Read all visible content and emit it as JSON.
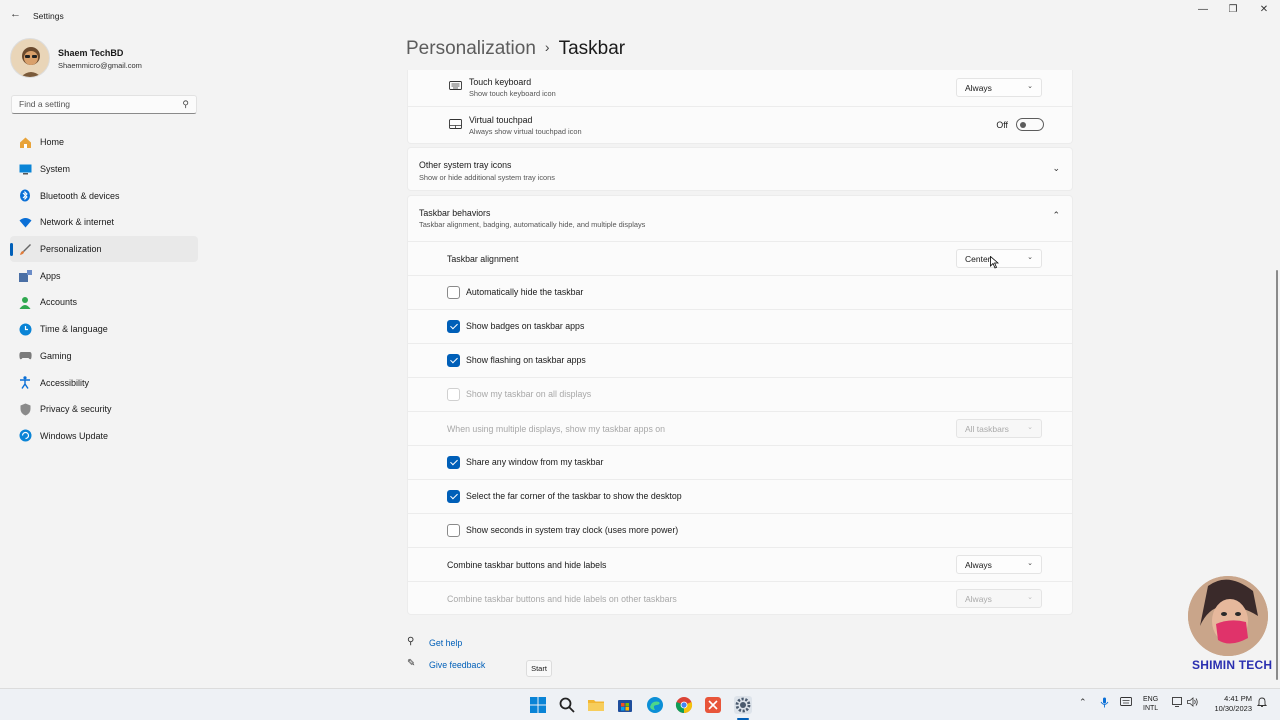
{
  "window": {
    "title": "Settings",
    "controls": [
      "—",
      "❐",
      "✕"
    ]
  },
  "profile": {
    "name": "Shaem TechBD",
    "email": "Shaemmicro@gmail.com"
  },
  "search": {
    "placeholder": "Find a setting"
  },
  "sidebar": {
    "items": [
      {
        "label": "Home",
        "icon": "home-icon",
        "color": "#d97706"
      },
      {
        "label": "System",
        "icon": "monitor-icon",
        "color": "#0078d4"
      },
      {
        "label": "Bluetooth & devices",
        "icon": "bluetooth-icon",
        "color": "#0078d4"
      },
      {
        "label": "Network & internet",
        "icon": "wifi-icon",
        "color": "#0078d4"
      },
      {
        "label": "Personalization",
        "icon": "brush-icon",
        "color": "#e07b39"
      },
      {
        "label": "Apps",
        "icon": "apps-icon",
        "color": "#4a6fa5"
      },
      {
        "label": "Accounts",
        "icon": "person-icon",
        "color": "#2fa84f"
      },
      {
        "label": "Time & language",
        "icon": "globe-clock-icon",
        "color": "#0078d4"
      },
      {
        "label": "Gaming",
        "icon": "gamepad-icon",
        "color": "#7a7a7a"
      },
      {
        "label": "Accessibility",
        "icon": "accessibility-icon",
        "color": "#0078d4"
      },
      {
        "label": "Privacy & security",
        "icon": "shield-icon",
        "color": "#7a7a7a"
      },
      {
        "label": "Windows Update",
        "icon": "update-icon",
        "color": "#0078d4"
      }
    ],
    "active_index": 4
  },
  "header": {
    "parent": "Personalization",
    "separator": "›",
    "current": "Taskbar"
  },
  "tray_items": {
    "touch_keyboard": {
      "title": "Touch keyboard",
      "subtitle": "Show touch keyboard icon",
      "value": "Always"
    },
    "virtual_touchpad": {
      "title": "Virtual touchpad",
      "subtitle": "Always show virtual touchpad icon",
      "state": "Off"
    }
  },
  "other_tray": {
    "title": "Other system tray icons",
    "subtitle": "Show or hide additional system tray icons"
  },
  "behaviors": {
    "title": "Taskbar behaviors",
    "subtitle": "Taskbar alignment, badging, automatically hide, and multiple displays",
    "alignment": {
      "label": "Taskbar alignment",
      "value": "Center"
    },
    "auto_hide": {
      "label": "Automatically hide the taskbar",
      "checked": false
    },
    "badges": {
      "label": "Show badges on taskbar apps",
      "checked": true
    },
    "flashing": {
      "label": "Show flashing on taskbar apps",
      "checked": true
    },
    "all_displays": {
      "label": "Show my taskbar on all displays",
      "checked": false
    },
    "multi_display": {
      "label": "When using multiple displays, show my taskbar apps on",
      "value": "All taskbars"
    },
    "share_window": {
      "label": "Share any window from my taskbar",
      "checked": true
    },
    "far_corner": {
      "label": "Select the far corner of the taskbar to show the desktop",
      "checked": true
    },
    "seconds": {
      "label": "Show seconds in system tray clock (uses more power)",
      "checked": false
    },
    "combine": {
      "label": "Combine taskbar buttons and hide labels",
      "value": "Always"
    },
    "combine_other": {
      "label": "Combine taskbar buttons and hide labels on other taskbars",
      "value": "Always"
    }
  },
  "help": {
    "get_help": "Get help",
    "give_feedback": "Give feedback"
  },
  "tooltip": "Start",
  "watermark": "SHIMIN TECH",
  "taskbar": {
    "lang_top": "ENG",
    "lang_bottom": "INTL",
    "time": "4:41 PM",
    "date": "10/30/2023"
  }
}
